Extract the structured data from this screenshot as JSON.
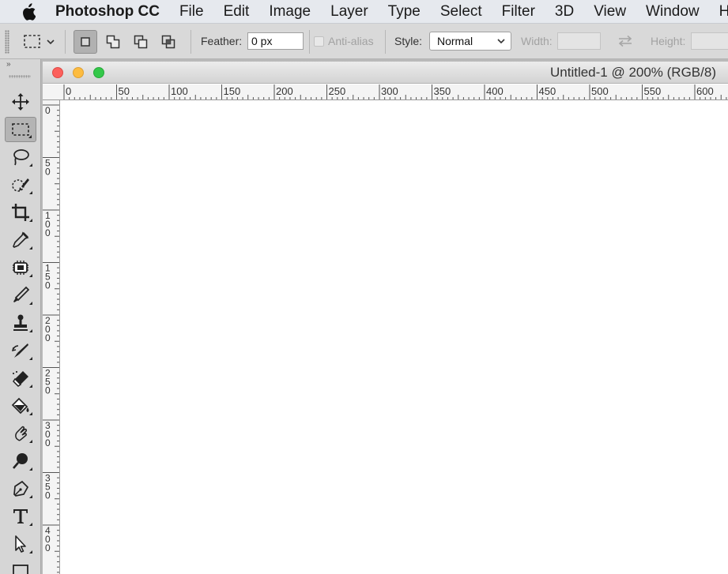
{
  "menubar": {
    "app_name": "Photoshop CC",
    "items": [
      "File",
      "Edit",
      "Image",
      "Layer",
      "Type",
      "Select",
      "Filter",
      "3D",
      "View",
      "Window",
      "Help"
    ]
  },
  "options": {
    "feather_label": "Feather:",
    "feather_value": "0 px",
    "antialias_label": "Anti-alias",
    "style_label": "Style:",
    "style_value": "Normal",
    "width_label": "Width:",
    "width_value": "",
    "height_label": "Height:",
    "height_value": ""
  },
  "document": {
    "title": "Untitled-1 @ 200% (RGB/8)"
  },
  "rulers": {
    "horizontal_labels": [
      "0",
      "50",
      "100",
      "150",
      "200",
      "250",
      "300",
      "350",
      "400",
      "450",
      "500",
      "550",
      "600"
    ],
    "vertical_labels": [
      "0",
      "50",
      "100",
      "150",
      "200",
      "250",
      "300",
      "350",
      "400"
    ]
  },
  "tools": [
    {
      "name": "move-tool",
      "icon": "move-arrows-icon"
    },
    {
      "name": "rectangular-marquee-tool",
      "icon": "marquee-icon",
      "active": true
    },
    {
      "name": "lasso-tool",
      "icon": "lasso-icon"
    },
    {
      "name": "quick-selection-tool",
      "icon": "quick-selection-icon"
    },
    {
      "name": "crop-tool",
      "icon": "crop-icon"
    },
    {
      "name": "eyedropper-tool",
      "icon": "eyedropper-icon"
    },
    {
      "name": "spot-healing-tool",
      "icon": "bandage-icon"
    },
    {
      "name": "brush-tool",
      "icon": "brush-icon"
    },
    {
      "name": "clone-stamp-tool",
      "icon": "stamp-icon"
    },
    {
      "name": "history-brush-tool",
      "icon": "history-brush-icon"
    },
    {
      "name": "eraser-tool",
      "icon": "eraser-icon"
    },
    {
      "name": "paint-bucket-tool",
      "icon": "paint-bucket-icon"
    },
    {
      "name": "smudge-tool",
      "icon": "smudge-icon"
    },
    {
      "name": "dodge-tool",
      "icon": "dodge-icon"
    },
    {
      "name": "pen-tool",
      "icon": "pen-icon"
    },
    {
      "name": "type-tool",
      "icon": "type-icon"
    },
    {
      "name": "path-selection-tool",
      "icon": "path-arrow-icon"
    },
    {
      "name": "rectangle-tool",
      "icon": "rectangle-icon"
    }
  ]
}
